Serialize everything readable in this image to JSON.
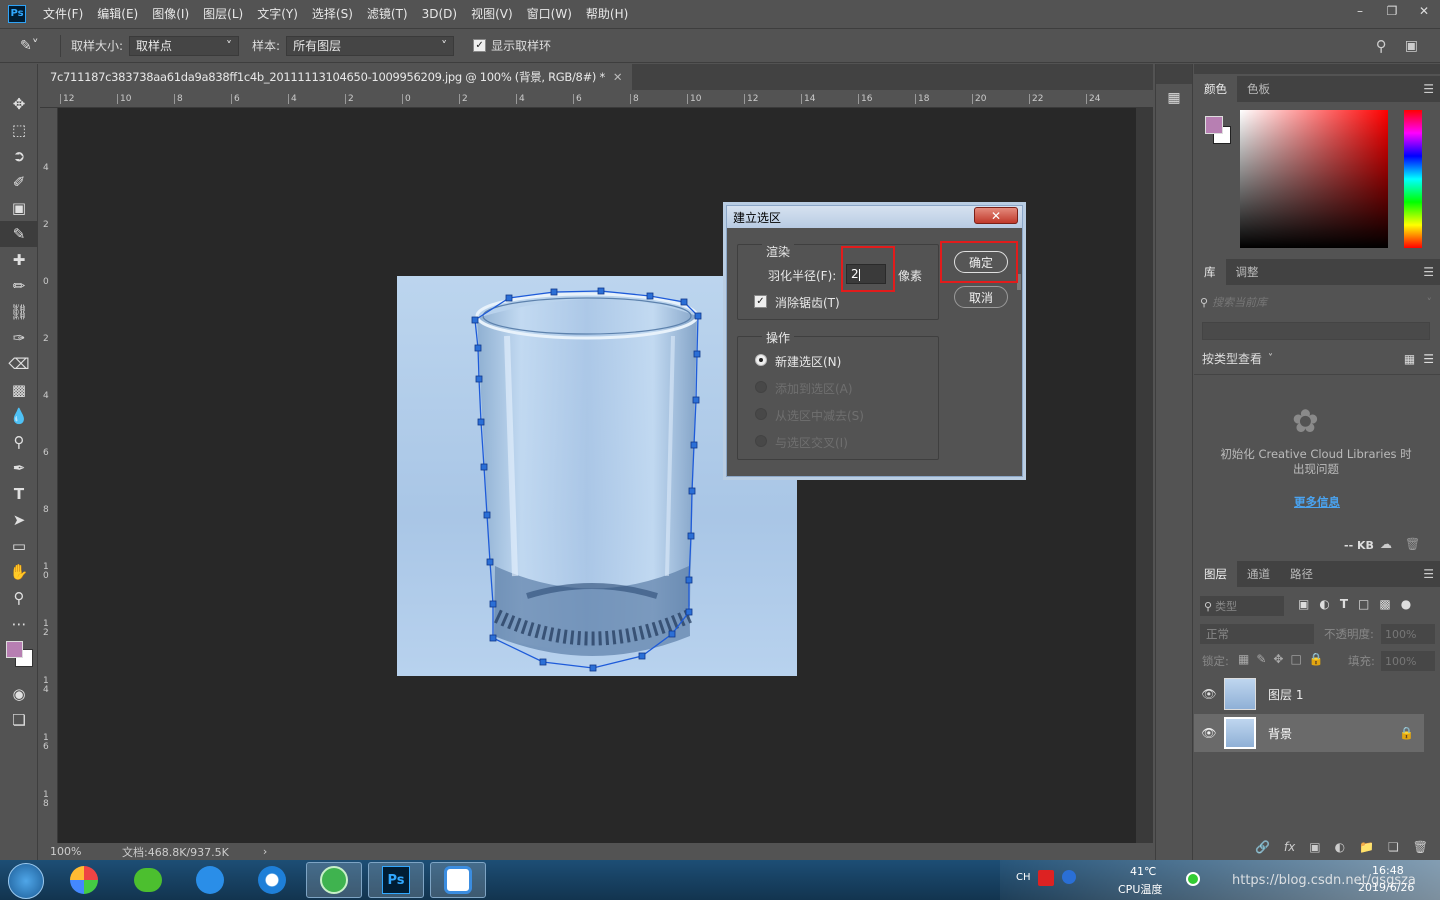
{
  "menubar": {
    "logo": "Ps",
    "items": [
      "文件(F)",
      "编辑(E)",
      "图像(I)",
      "图层(L)",
      "文字(Y)",
      "选择(S)",
      "滤镜(T)",
      "3D(D)",
      "视图(V)",
      "窗口(W)",
      "帮助(H)"
    ]
  },
  "options": {
    "sample_size_label": "取样大小:",
    "sample_size_value": "取样点",
    "sample_label": "样本:",
    "sample_value": "所有图层",
    "show_ring_label": "显示取样环"
  },
  "document": {
    "tab_title": "7c711187c383738aa61da9a838ff1c4b_20111113104650-1009956209.jpg @ 100% (背景, RGB/8#) *",
    "hruler_labels": [
      "12",
      "10",
      "8",
      "6",
      "4",
      "2",
      "0",
      "2",
      "4",
      "6",
      "8",
      "10",
      "12",
      "14",
      "16",
      "18",
      "20",
      "22",
      "24"
    ],
    "vruler_labels": [
      "4",
      "2",
      "0",
      "2",
      "4",
      "6",
      "8",
      "1 0",
      "1 2",
      "1 4",
      "1 6",
      "1 8"
    ],
    "zoom": "100%",
    "doc_info": "文档:468.8K/937.5K"
  },
  "dialog": {
    "title": "建立选区",
    "render_group": "渲染",
    "feather_label": "羽化半径(F):",
    "feather_value": "2",
    "feather_unit": "像素",
    "antialias_label": "消除锯齿(T)",
    "operation_group": "操作",
    "ops": [
      "新建选区(N)",
      "添加到选区(A)",
      "从选区中减去(S)",
      "与选区交叉(I)"
    ],
    "ok": "确定",
    "cancel": "取消"
  },
  "color_panel": {
    "tabs": [
      "颜色",
      "色板"
    ],
    "fg_color": "#b77fb2",
    "bg_color": "#ffffff"
  },
  "library_panel": {
    "tabs": [
      "库",
      "调整"
    ],
    "search_placeholder": "搜索当前库",
    "view_label": "按类型查看",
    "message": "初始化 Creative Cloud Libraries 时出现问题",
    "more_info": "更多信息",
    "size": "-- KB"
  },
  "layers_panel": {
    "tabs": [
      "图层",
      "通道",
      "路径"
    ],
    "filter_label": "类型",
    "blend_mode": "正常",
    "opacity_label": "不透明度:",
    "opacity_value": "100%",
    "lock_label": "锁定:",
    "fill_label": "填充:",
    "fill_value": "100%",
    "layers": [
      {
        "name": "图层 1"
      },
      {
        "name": "背景"
      }
    ]
  },
  "taskbar": {
    "ime": "CH",
    "temp": "41℃",
    "cpu_label": "CPU温度",
    "time": "16:48",
    "date": "2019/6/26",
    "watermark": "https://blog.csdn.net/gsgsza"
  }
}
